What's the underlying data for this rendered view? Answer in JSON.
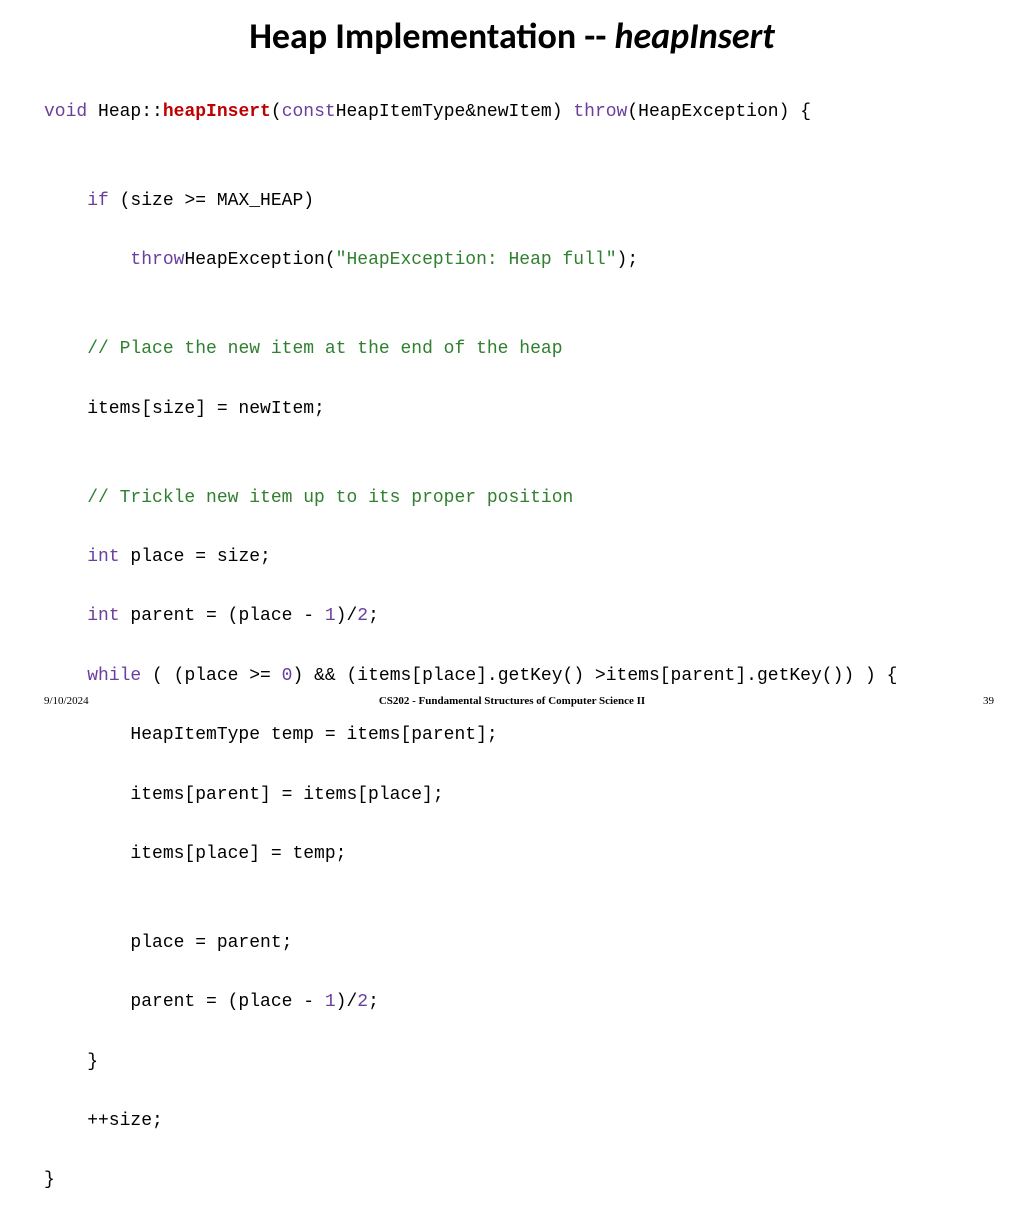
{
  "title": {
    "pre": "Heap Implementation -- ",
    "ital": "heapInsert"
  },
  "code": {
    "l1": {
      "a": "void",
      "b": " Heap::",
      "c": "heapInsert",
      "d": "(",
      "e": "const",
      "f": "HeapItemType&newItem) ",
      "g": "throw",
      "h": "(HeapException) {"
    },
    "l2": "",
    "l3": {
      "a": "    ",
      "b": "if",
      "c": " (size >= MAX_HEAP)"
    },
    "l4": {
      "a": "        ",
      "b": "throw",
      "c": "HeapException(",
      "d": "\"HeapException: Heap full\"",
      "e": ");"
    },
    "l5": "",
    "l6": {
      "a": "    ",
      "b": "// Place the new item at the end of the heap"
    },
    "l7": "    items[size] = newItem;",
    "l8": "",
    "l9": {
      "a": "    ",
      "b": "// Trickle new item up to its proper position"
    },
    "l10": {
      "a": "    ",
      "b": "int",
      "c": " place = size;"
    },
    "l11": {
      "a": "    ",
      "b": "int",
      "c": " parent = (place - ",
      "d": "1",
      "e": ")/",
      "f": "2",
      "g": ";"
    },
    "l12": {
      "a": "    ",
      "b": "while",
      "c": " ( (place >= ",
      "d": "0",
      "e": ") && (items[place].getKey() >items[parent].getKey()) ) {"
    },
    "l13": "        HeapItemType temp = items[parent];",
    "l14": "        items[parent] = items[place];",
    "l15": "        items[place] = temp;",
    "l16": "",
    "l17": "        place = parent;",
    "l18": {
      "a": "        parent = (place - ",
      "b": "1",
      "c": ")/",
      "d": "2",
      "e": ";"
    },
    "l19": "    }",
    "l20": "    ++size;",
    "l21": "}"
  },
  "footer": {
    "date": "9/10/2024",
    "course": "CS202 - Fundamental Structures of Computer Science II",
    "page": "39"
  }
}
